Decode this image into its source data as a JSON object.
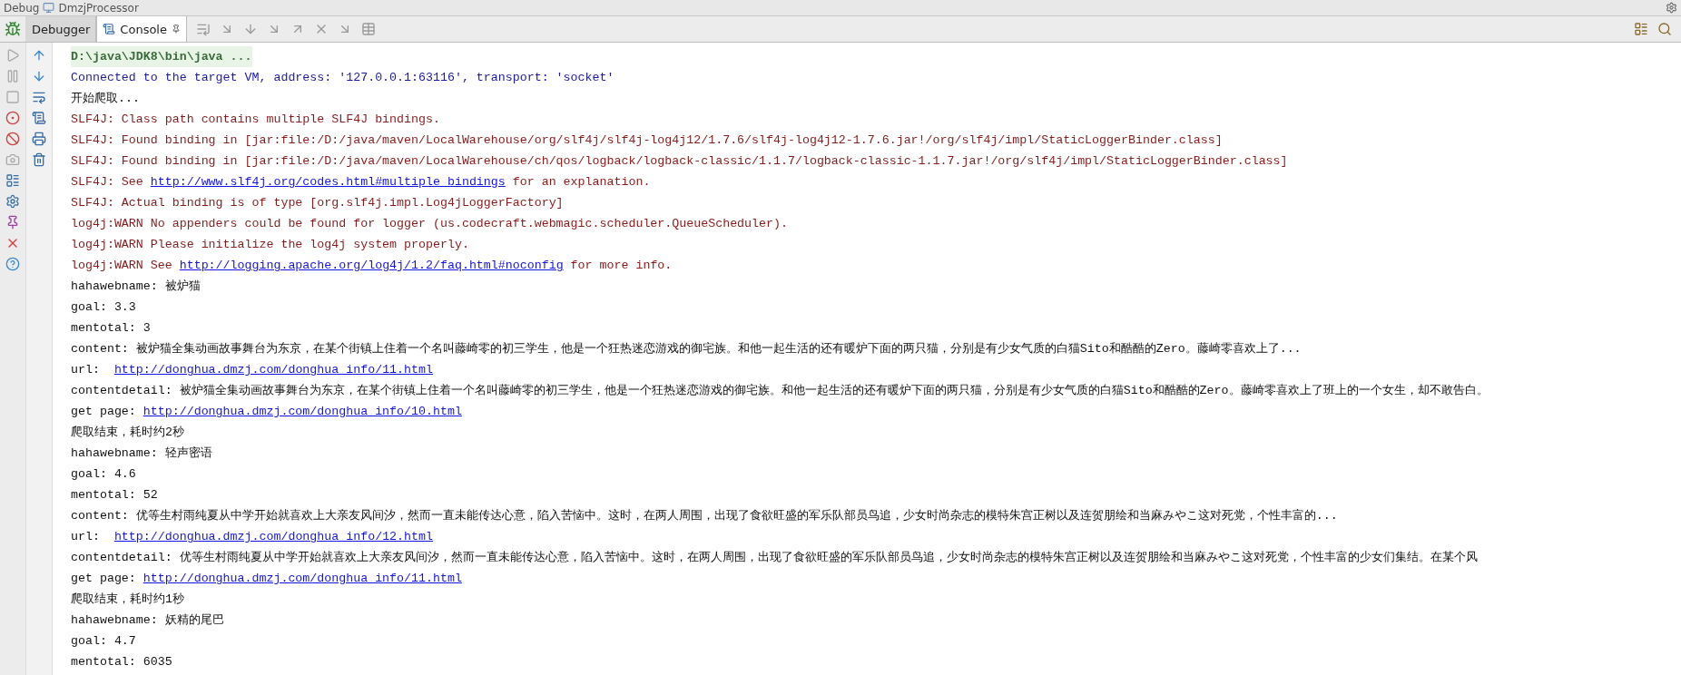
{
  "window": {
    "panel": "Debug",
    "title": "DmzjProcessor"
  },
  "tabs": [
    {
      "label": "Debugger",
      "selected": false
    },
    {
      "label": "Console",
      "selected": true
    }
  ],
  "console": {
    "lines": [
      {
        "kind": "command",
        "text": "D:\\java\\JDK8\\bin\\java ..."
      },
      {
        "kind": "info",
        "text": "Connected to the target VM, address: '127.0.0.1:63116', transport: 'socket'"
      },
      {
        "kind": "output",
        "text": "开始爬取..."
      },
      {
        "kind": "error",
        "text": "SLF4J: Class path contains multiple SLF4J bindings."
      },
      {
        "kind": "error",
        "text": "SLF4J: Found binding in [jar:file:/D:/java/maven/LocalWarehouse/org/slf4j/slf4j-log4j12/1.7.6/slf4j-log4j12-1.7.6.jar!/org/slf4j/impl/StaticLoggerBinder.class]"
      },
      {
        "kind": "error",
        "text": "SLF4J: Found binding in [jar:file:/D:/java/maven/LocalWarehouse/ch/qos/logback/logback-classic/1.1.7/logback-classic-1.1.7.jar!/org/slf4j/impl/StaticLoggerBinder.class]"
      },
      {
        "kind": "error",
        "text": "SLF4J: See ",
        "link": "http://www.slf4j.org/codes.html#multiple_bindings",
        "after": " for an explanation."
      },
      {
        "kind": "error",
        "text": "SLF4J: Actual binding is of type [org.slf4j.impl.Log4jLoggerFactory]"
      },
      {
        "kind": "error",
        "text": "log4j:WARN No appenders could be found for logger (us.codecraft.webmagic.scheduler.QueueScheduler)."
      },
      {
        "kind": "error",
        "text": "log4j:WARN Please initialize the log4j system properly."
      },
      {
        "kind": "error",
        "text": "log4j:WARN See ",
        "link": "http://logging.apache.org/log4j/1.2/faq.html#noconfig",
        "after": " for more info."
      },
      {
        "kind": "output",
        "text": "hahawebname: 被炉猫"
      },
      {
        "kind": "output",
        "text": "goal: 3.3"
      },
      {
        "kind": "output",
        "text": "mentotal: 3"
      },
      {
        "kind": "output",
        "text": "content: 被炉猫全集动画故事舞台为东京，在某个街镇上住着一个名叫藤崎零的初三学生，他是一个狂热迷恋游戏的御宅族。和他一起生活的还有暖炉下面的两只猫，分别是有少女气质的白猫Sito和酷酷的Zero。藤崎零喜欢上了..."
      },
      {
        "kind": "output",
        "text": "url:  ",
        "link": "http://donghua.dmzj.com/donghua_info/11.html"
      },
      {
        "kind": "output",
        "text": "contentdetail: 被炉猫全集动画故事舞台为东京，在某个街镇上住着一个名叫藤崎零的初三学生，他是一个狂热迷恋游戏的御宅族。和他一起生活的还有暖炉下面的两只猫，分别是有少女气质的白猫Sito和酷酷的Zero。藤崎零喜欢上了班上的一个女生，却不敢告白。"
      },
      {
        "kind": "output",
        "text": "get page: ",
        "link": "http://donghua.dmzj.com/donghua_info/10.html"
      },
      {
        "kind": "output",
        "text": "爬取结束，耗时约2秒"
      },
      {
        "kind": "output",
        "text": "hahawebname: 轻声密语"
      },
      {
        "kind": "output",
        "text": "goal: 4.6"
      },
      {
        "kind": "output",
        "text": "mentotal: 52"
      },
      {
        "kind": "output",
        "text": "content: 优等生村雨纯夏从中学开始就喜欢上大亲友风间汐，然而一直未能传达心意，陷入苦恼中。这时，在两人周围，出现了食欲旺盛的军乐队部员鸟追，少女时尚杂志的模特朱宫正树以及连贺朋绘和当麻みやこ这对死党，个性丰富的..."
      },
      {
        "kind": "output",
        "text": "url:  ",
        "link": "http://donghua.dmzj.com/donghua_info/12.html"
      },
      {
        "kind": "output",
        "text": "contentdetail: 优等生村雨纯夏从中学开始就喜欢上大亲友风间汐，然而一直未能传达心意，陷入苦恼中。这时，在两人周围，出现了食欲旺盛的军乐队部员鸟追，少女时尚杂志的模特朱宫正树以及连贺朋绘和当麻みやこ这对死党，个性丰富的少女们集结。在某个风"
      },
      {
        "kind": "output",
        "text": "get page: ",
        "link": "http://donghua.dmzj.com/donghua_info/11.html"
      },
      {
        "kind": "output",
        "text": "爬取结束，耗时约1秒"
      },
      {
        "kind": "output",
        "text": "hahawebname: 妖精的尾巴"
      },
      {
        "kind": "output",
        "text": "goal: 4.7"
      },
      {
        "kind": "output",
        "text": "mentotal: 6035"
      }
    ]
  }
}
